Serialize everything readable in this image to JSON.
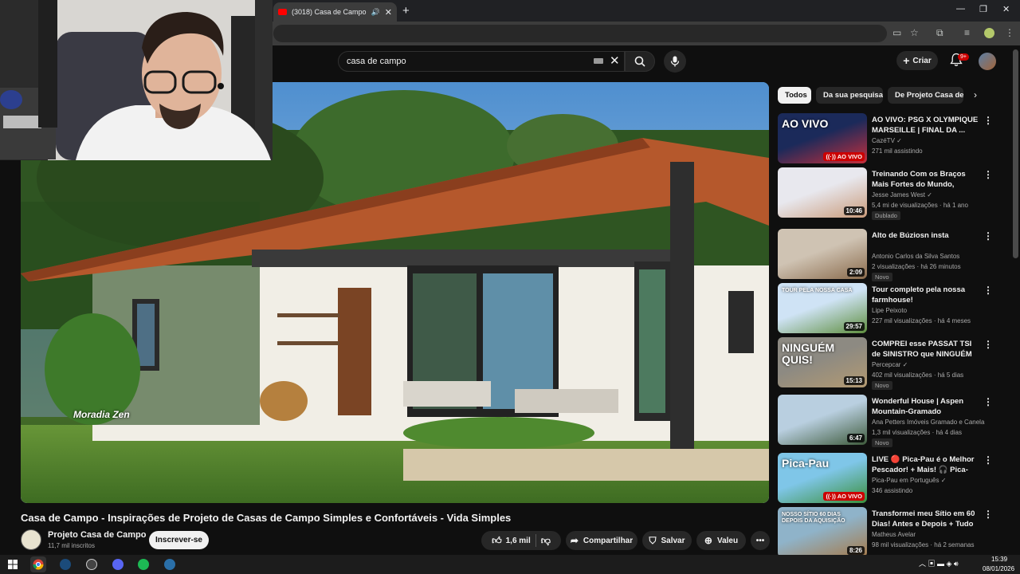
{
  "browser": {
    "tab_title": "(3018) Casa de Campo - Inspirações",
    "new_tab": "+",
    "minimize": "—",
    "restore": "❐",
    "close": "✕"
  },
  "header": {
    "search_value": "casa de campo",
    "create_label": "Criar",
    "notif_count": "9+"
  },
  "video": {
    "title": "Casa de Campo - Inspirações de Projeto de Casas de Campo Simples e Confortáveis - Vida Simples",
    "watermark": "Moradia Zen",
    "channel_name": "Projeto Casa de Campo",
    "subscribers": "11,7 mil inscritos",
    "subscribe_label": "Inscrever-se",
    "likes": "1,6 mil",
    "share_label": "Compartilhar",
    "save_label": "Salvar",
    "thanks_label": "Valeu"
  },
  "chips": [
    "Todos",
    "Da sua pesquisa",
    "De Projeto Casa de Campo"
  ],
  "recommendations": [
    {
      "title": "AO VIVO: PSG X OLYMPIQUE MARSEILLE | FINAL DA ...",
      "channel": "CazéTV ✓",
      "meta": "271 mil assistindo",
      "badge": "",
      "thumb_text": "AO VIVO",
      "overlay": "((·)) AO VIVO",
      "colors": [
        "#1b2a5a",
        "#c72f3c"
      ]
    },
    {
      "title": "Treinando Com os Braços Mais Fortes do Mundo, Ramon Dino",
      "channel": "Jesse James West ✓",
      "meta": "5,4 mi de visualizações · há 1 ano",
      "badge": "Dublado",
      "thumb_text": "",
      "overlay": "10:46",
      "colors": [
        "#e8e8ee",
        "#c99a7a"
      ]
    },
    {
      "title": "Alto de Búziosn insta",
      "channel": "Antonio Carlos da Silva Santos",
      "meta": "2 visualizações · há 26 minutos",
      "badge": "Novo",
      "thumb_text": "",
      "overlay": "2:09",
      "colors": [
        "#cfc3b3",
        "#8a6b4c"
      ]
    },
    {
      "title": "Tour completo pela nossa farmhouse!",
      "channel": "Lipe Peixoto",
      "meta": "227 mil visualizações · há 4 meses",
      "badge": "",
      "thumb_text": "TOUR PELA NOSSA CASA",
      "overlay": "29:57",
      "colors": [
        "#cfe3f5",
        "#5e8e3e"
      ]
    },
    {
      "title": "COMPREI esse PASSAT TSI de SINISTRO que NINGUÉM QUIS...",
      "channel": "Percepcar ✓",
      "meta": "402 mil visualizações · há 5 dias",
      "badge": "Novo",
      "thumb_text": "NINGUÉM QUIS!",
      "overlay": "15:13",
      "colors": [
        "#8d8a82",
        "#b39a72"
      ]
    },
    {
      "title": "Wonderful House | Aspen Mountain-Gramado",
      "channel": "Ana Petters Imóveis Gramado e Canela",
      "meta": "1,3 mil visualizações · há 4 dias",
      "badge": "Novo",
      "thumb_text": "",
      "overlay": "6:47",
      "colors": [
        "#b9cfe0",
        "#3e5a3b"
      ]
    },
    {
      "title": "LIVE 🔴 Pica-Pau é o Melhor Pescador! + Mais! 🎧 Pica-Pa...",
      "channel": "Pica-Pau em Português ✓",
      "meta": "346 assistindo",
      "badge": "",
      "thumb_text": "Pica-Pau",
      "overlay": "((·)) AO VIVO",
      "colors": [
        "#7fc6e8",
        "#3b8f3b"
      ]
    },
    {
      "title": "Transformei meu Sítio em 60 Dias! Antes e Depois + Tudo q...",
      "channel": "Matheus Avelar",
      "meta": "98 mil visualizações · há 2 semanas",
      "badge": "",
      "thumb_text": "NOSSO SÍTIO 60 DIAS DEPOIS DA AQUISIÇÃO",
      "overlay": "8:26",
      "colors": [
        "#8fb3c9",
        "#a57a4a"
      ]
    }
  ],
  "taskbar": {
    "time": "15:39",
    "date": "08/01/2026",
    "apps": [
      "windows-start",
      "chrome",
      "steam",
      "obs",
      "discord",
      "spotify",
      "steam-2"
    ]
  },
  "colors": {
    "background": "#0f0f0f",
    "accent_red": "#cc0000",
    "chip_active": "#f1f1f1"
  }
}
